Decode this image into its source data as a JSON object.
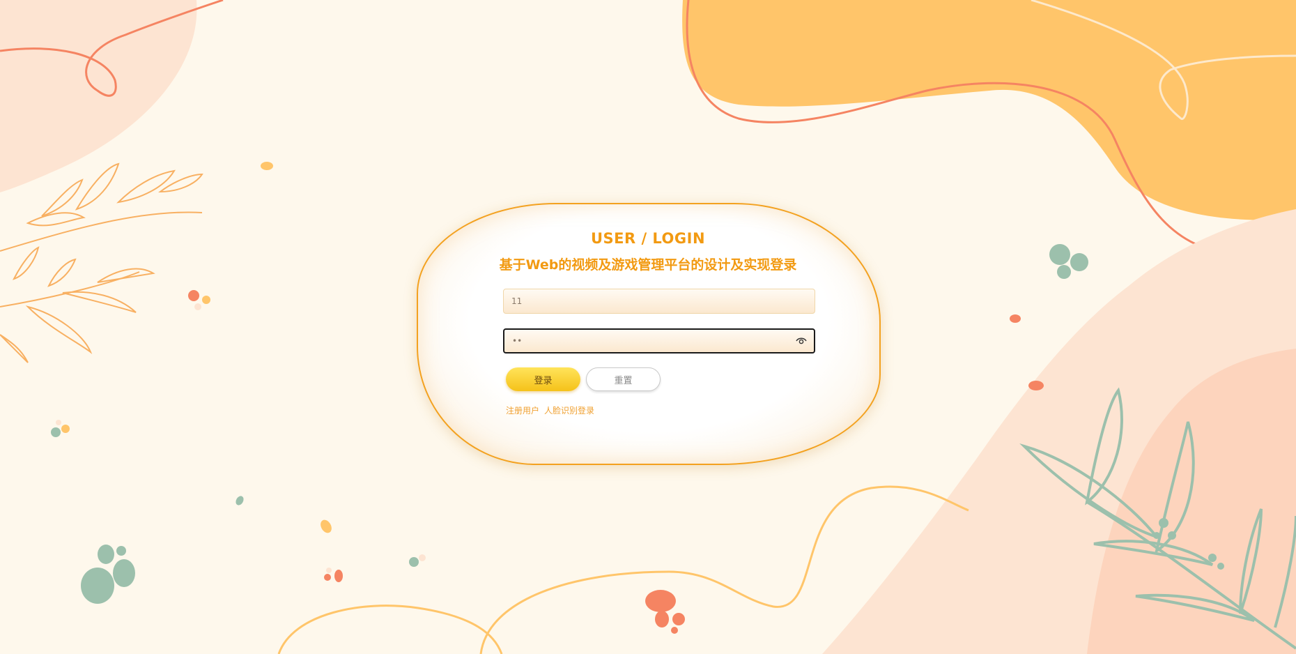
{
  "header": {
    "title_en": "USER / LOGIN",
    "title_cn": "基于Web的视频及游戏管理平台的设计及实现登录"
  },
  "form": {
    "username_value": "11",
    "password_mask": "••",
    "login_label": "登录",
    "reset_label": "重置"
  },
  "links": {
    "register": "注册用户",
    "face_login": "人脸识别登录"
  },
  "colors": {
    "accent": "#f29a12",
    "background": "#fef8ec",
    "blob_orange": "#ffc56a",
    "blob_peach": "#fddcc6",
    "leaf_green": "#9cc0ac",
    "line_coral": "#f58462"
  },
  "icons": {
    "password_toggle": "eye-icon"
  }
}
